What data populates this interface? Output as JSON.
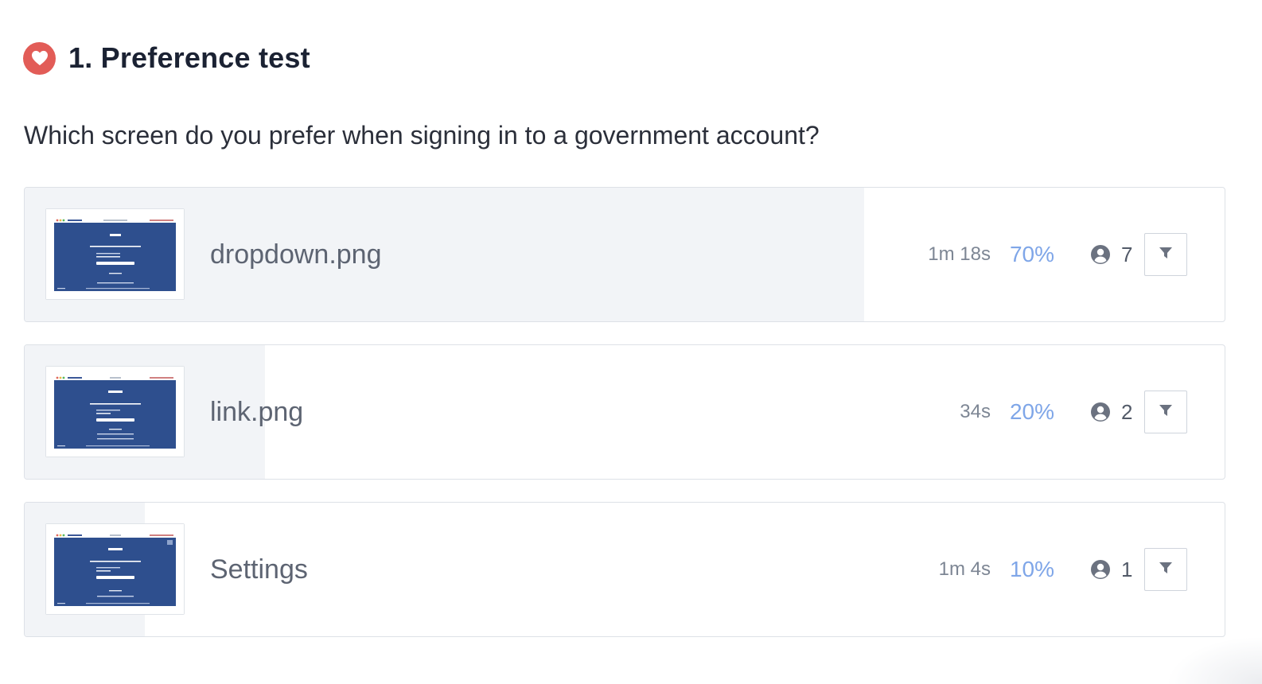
{
  "header": {
    "title": "1. Preference test",
    "icon": "heart-icon",
    "icon_color": "#e25c57"
  },
  "question": "Which screen do you prefer when signing in to a government account?",
  "accent_color": "#7fa6e8",
  "options": [
    {
      "label": "dropdown.png",
      "duration": "1m 18s",
      "percent": "70%",
      "share": 0.7,
      "users": "7"
    },
    {
      "label": "link.png",
      "duration": "34s",
      "percent": "20%",
      "share": 0.2,
      "users": "2"
    },
    {
      "label": "Settings",
      "duration": "1m 4s",
      "percent": "10%",
      "share": 0.1,
      "users": "1"
    }
  ]
}
